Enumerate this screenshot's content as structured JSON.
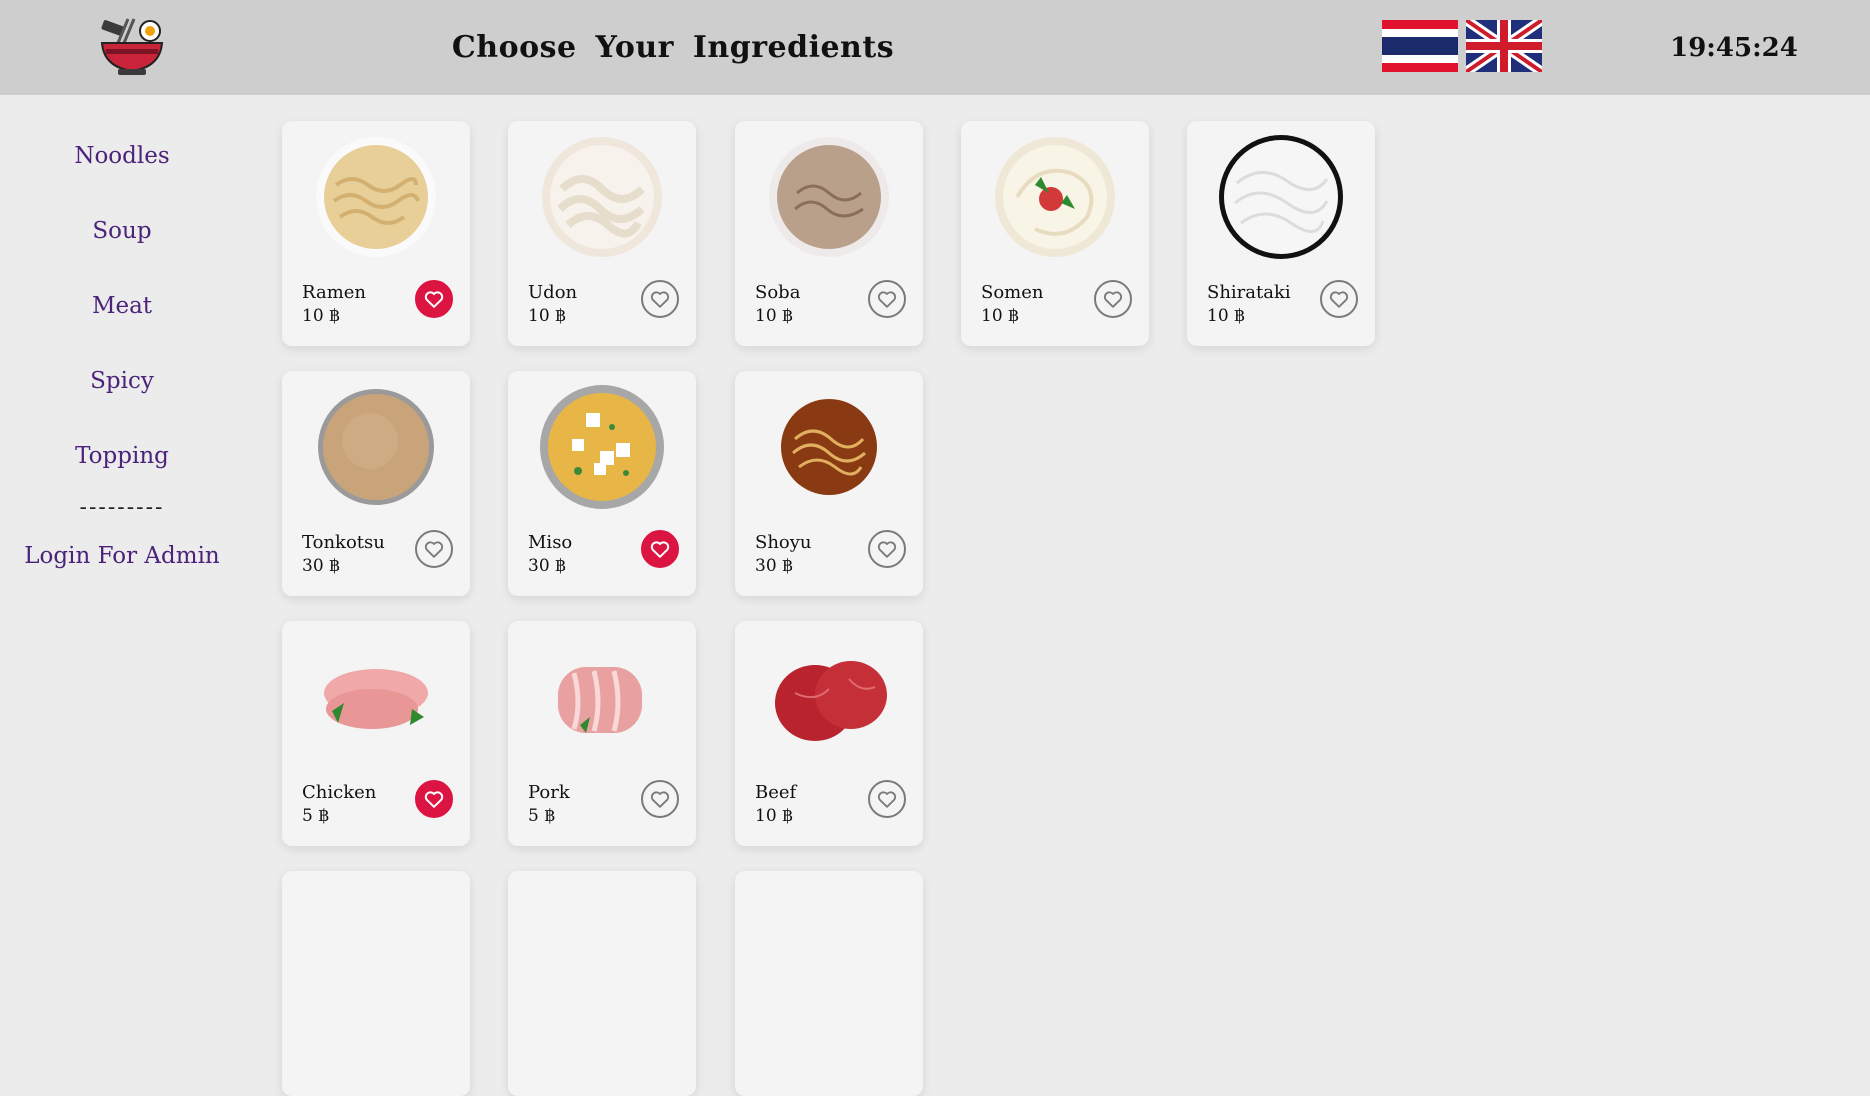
{
  "header": {
    "title": "Choose  Your  Ingredients",
    "clock": "19:45:24",
    "logo_icon": "ramen-bowl-logo-icon",
    "languages": [
      {
        "name": "thai-flag-icon"
      },
      {
        "name": "uk-flag-icon"
      }
    ]
  },
  "sidebar": {
    "items": [
      {
        "label": "Noodles"
      },
      {
        "label": "Soup"
      },
      {
        "label": "Meat"
      },
      {
        "label": "Spicy"
      },
      {
        "label": "Topping"
      }
    ],
    "divider": "---------",
    "admin_login": "Login For Admin"
  },
  "colors": {
    "accent": "#4b237a",
    "favorite_active": "#dc1442",
    "header_bg": "#cecece",
    "page_bg": "#ececec"
  },
  "ingredients": [
    {
      "name": "Ramen",
      "price": "10 ฿",
      "favorite": true,
      "image": "ramen-noodles-image"
    },
    {
      "name": "Udon",
      "price": "10 ฿",
      "favorite": false,
      "image": "udon-noodles-image"
    },
    {
      "name": "Soba",
      "price": "10 ฿",
      "favorite": false,
      "image": "soba-noodles-image"
    },
    {
      "name": "Somen",
      "price": "10 ฿",
      "favorite": false,
      "image": "somen-noodles-image"
    },
    {
      "name": "Shirataki",
      "price": "10 ฿",
      "favorite": false,
      "image": "shirataki-noodles-image"
    },
    {
      "name": "Tonkotsu",
      "price": "30 ฿",
      "favorite": false,
      "image": "tonkotsu-soup-image"
    },
    {
      "name": "Miso",
      "price": "30 ฿",
      "favorite": true,
      "image": "miso-soup-image"
    },
    {
      "name": "Shoyu",
      "price": "30 ฿",
      "favorite": false,
      "image": "shoyu-soup-image"
    },
    {
      "name": "Chicken",
      "price": "5 ฿",
      "favorite": true,
      "image": "chicken-meat-image"
    },
    {
      "name": "Pork",
      "price": "5 ฿",
      "favorite": false,
      "image": "pork-meat-image"
    },
    {
      "name": "Beef",
      "price": "10 ฿",
      "favorite": false,
      "image": "beef-meat-image"
    },
    {
      "name": "",
      "price": "",
      "favorite": false,
      "image": ""
    },
    {
      "name": "",
      "price": "",
      "favorite": false,
      "image": ""
    },
    {
      "name": "",
      "price": "",
      "favorite": false,
      "image": ""
    }
  ]
}
